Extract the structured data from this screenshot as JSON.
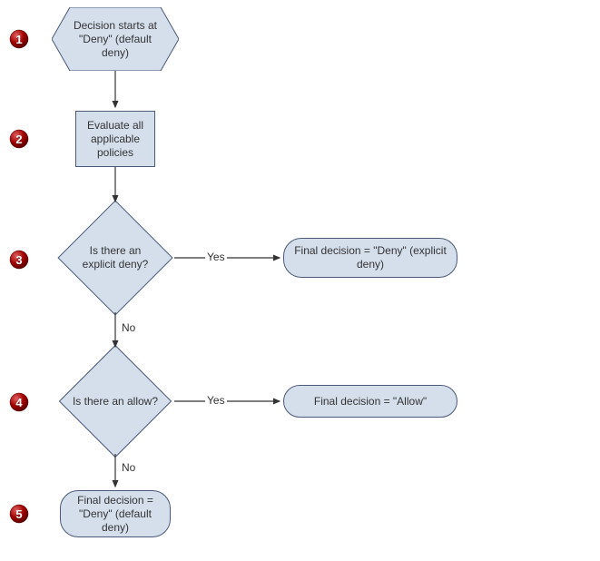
{
  "badges": {
    "n1": "1",
    "n2": "2",
    "n3": "3",
    "n4": "4",
    "n5": "5"
  },
  "nodes": {
    "start": "Decision starts at \"Deny\" (default deny)",
    "evaluate": "Evaluate all applicable policies",
    "q_explicit_deny": "Is there an explicit deny?",
    "q_allow": "Is there an allow?",
    "final_deny_explicit": "Final decision = \"Deny\" (explicit deny)",
    "final_allow": "Final decision = \"Allow\"",
    "final_deny_default": "Final decision = \"Deny\" (default deny)"
  },
  "edges": {
    "yes": "Yes",
    "no": "No"
  },
  "chart_data": {
    "type": "flowchart",
    "nodes": [
      {
        "id": "start",
        "kind": "terminator",
        "text": "Decision starts at \"Deny\" (default deny)"
      },
      {
        "id": "evaluate",
        "kind": "process",
        "text": "Evaluate all applicable policies"
      },
      {
        "id": "q_explicit_deny",
        "kind": "decision",
        "text": "Is there an explicit deny?"
      },
      {
        "id": "q_allow",
        "kind": "decision",
        "text": "Is there an allow?"
      },
      {
        "id": "final_deny_explicit",
        "kind": "terminator",
        "text": "Final decision = \"Deny\" (explicit deny)"
      },
      {
        "id": "final_allow",
        "kind": "terminator",
        "text": "Final decision = \"Allow\""
      },
      {
        "id": "final_deny_default",
        "kind": "terminator",
        "text": "Final decision = \"Deny\" (default deny)"
      }
    ],
    "edges": [
      {
        "from": "start",
        "to": "evaluate",
        "label": ""
      },
      {
        "from": "evaluate",
        "to": "q_explicit_deny",
        "label": ""
      },
      {
        "from": "q_explicit_deny",
        "to": "final_deny_explicit",
        "label": "Yes"
      },
      {
        "from": "q_explicit_deny",
        "to": "q_allow",
        "label": "No"
      },
      {
        "from": "q_allow",
        "to": "final_allow",
        "label": "Yes"
      },
      {
        "from": "q_allow",
        "to": "final_deny_default",
        "label": "No"
      }
    ],
    "step_markers": [
      {
        "marker": "1",
        "node": "start"
      },
      {
        "marker": "2",
        "node": "evaluate"
      },
      {
        "marker": "3",
        "node": "q_explicit_deny"
      },
      {
        "marker": "4",
        "node": "q_allow"
      },
      {
        "marker": "5",
        "node": "final_deny_default"
      }
    ]
  }
}
